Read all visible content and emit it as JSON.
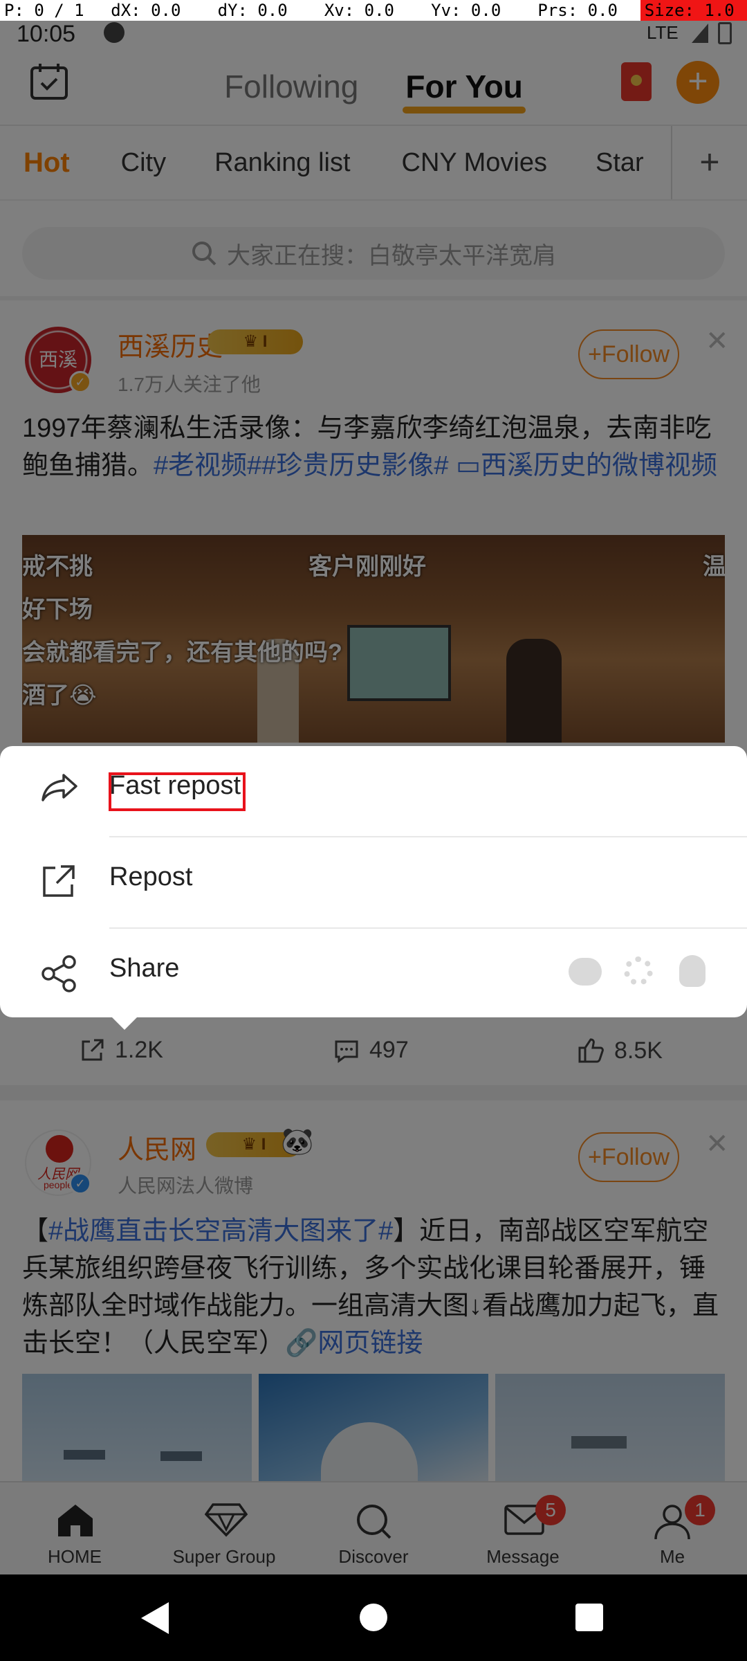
{
  "debug_bar": {
    "p": "P: 0 / 1",
    "dx": "dX: 0.0",
    "dy": "dY: 0.0",
    "xv": "Xv: 0.0",
    "yv": "Yv: 0.0",
    "prs": "Prs: 0.0",
    "size": "Size: 1.0"
  },
  "status_bar": {
    "time": "10:05",
    "network": "LTE"
  },
  "header": {
    "tabs": [
      {
        "label": "Following",
        "selected": false
      },
      {
        "label": "For You",
        "selected": true
      }
    ]
  },
  "channels": [
    "Hot",
    "City",
    "Ranking list",
    "CNY Movies",
    "Star"
  ],
  "search": {
    "placeholder": "大家正在搜：白敬亭太平洋宽肩"
  },
  "post1": {
    "avatar_text": "西溪",
    "username": "西溪历史",
    "followers": "1.7万人关注了他",
    "follow_label": "Follow",
    "text": "1997年蔡澜私生活录像：与李嘉欣李绮红泡温泉，去南非吃鲍鱼捕猎。",
    "tags": "#老视频##珍贵历史影像#",
    "video_link": "西溪历史的微博视频",
    "video_captions": [
      "戒不挑",
      "客户刚刚好",
      "温",
      "好下场",
      "会就都看完了，还有其他的吗?",
      "酒了😭"
    ],
    "reposts": "1.2K",
    "comments": "497",
    "likes": "8.5K"
  },
  "post2": {
    "avatar_text": "人民网",
    "avatar_sub": "people",
    "username": "人民网",
    "subtitle": "人民网法人微博",
    "follow_label": "Follow",
    "text_open": "【",
    "tag": "#战鹰直击长空高清大图来了#",
    "text": "】近日，南部战区空军航空兵某旅组织跨昼夜飞行训练，多个实战化课目轮番展开，锤炼部队全时域作战能力。一组高清大图↓看战鹰加力起飞，直击长空！（人民空军）",
    "link": "网页链接"
  },
  "vip_badge": "I",
  "share_sheet": {
    "items": [
      {
        "label": "Fast repost",
        "icon": "forward-arrow-icon"
      },
      {
        "label": "Repost",
        "icon": "external-repost-icon"
      },
      {
        "label": "Share",
        "icon": "share-nodes-icon"
      }
    ],
    "share_targets": [
      "wechat-icon",
      "moments-icon",
      "qq-icon"
    ]
  },
  "bottom_nav": [
    {
      "label": "HOME",
      "icon": "home-icon",
      "badge": ""
    },
    {
      "label": "Super Group",
      "icon": "diamond-icon",
      "badge": ""
    },
    {
      "label": "Discover",
      "icon": "search-icon",
      "badge": ""
    },
    {
      "label": "Message",
      "icon": "mail-icon",
      "badge": "5"
    },
    {
      "label": "Me",
      "icon": "person-icon",
      "badge": "1"
    }
  ],
  "colors": {
    "accent": "#ff8200",
    "link": "#3b6fd8",
    "highlight_box": "#e8121b",
    "badge": "#f0392f"
  }
}
